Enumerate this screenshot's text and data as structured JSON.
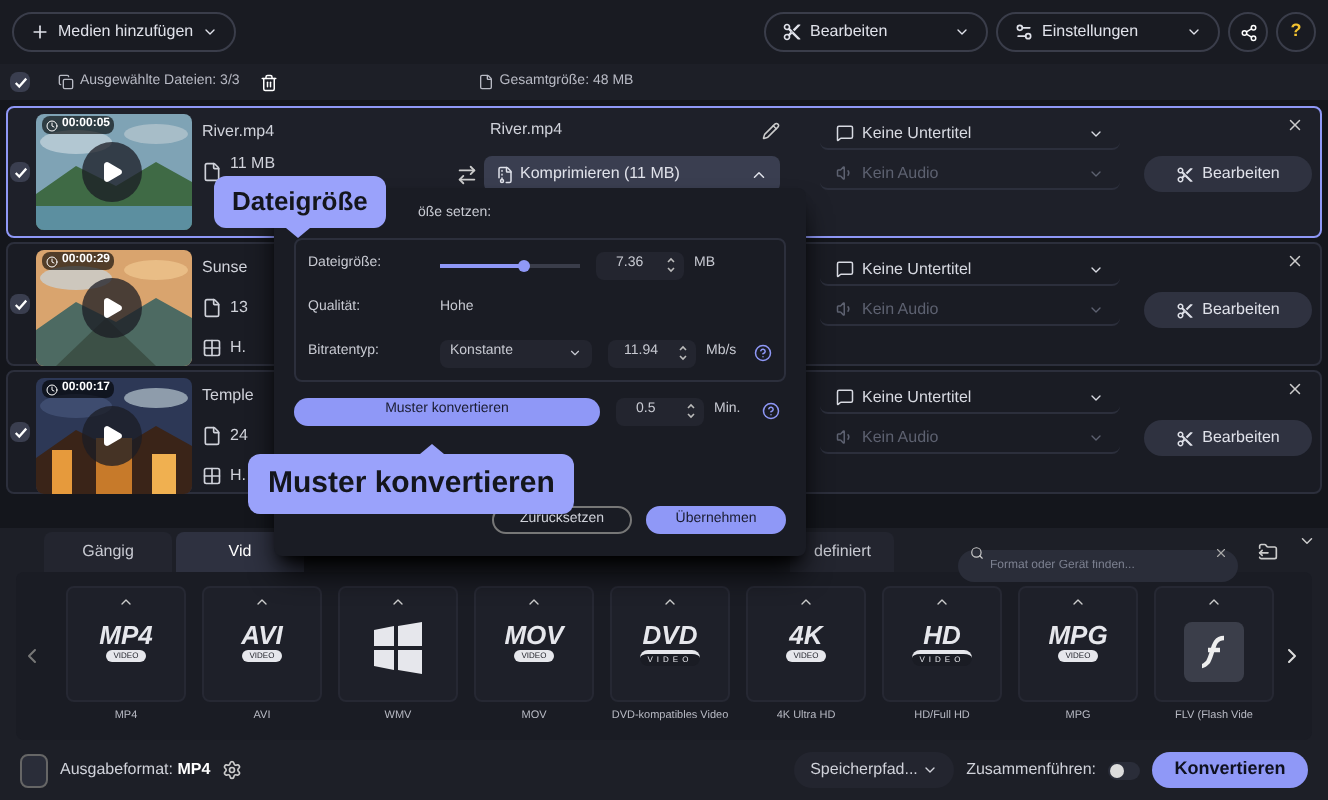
{
  "toolbar": {
    "add_media": "Medien hinzufügen",
    "edit": "Bearbeiten",
    "settings": "Einstellungen",
    "help": "?"
  },
  "selection_bar": {
    "checked": true,
    "selected_files": "Ausgewählte Dateien: 3/3",
    "total_size": "Gesamtgröße: 48 MB"
  },
  "files": [
    {
      "selected": true,
      "checked": true,
      "duration": "00:00:05",
      "name": "River.mp4",
      "size": "11 MB",
      "output_name": "River.mp4",
      "compress": {
        "label": "Komprimieren (11 MB)",
        "expanded": true
      },
      "subtitles": "Keine Untertitel",
      "audio": "Kein Audio",
      "edit": "Bearbeiten"
    },
    {
      "selected": false,
      "checked": true,
      "duration": "00:00:29",
      "name": "Sunse",
      "size": "13",
      "codec": "H.",
      "subtitles": "Keine Untertitel",
      "audio": "Kein Audio",
      "edit": "Bearbeiten"
    },
    {
      "selected": false,
      "checked": true,
      "duration": "00:00:17",
      "name": "Temple",
      "size": "24",
      "codec": "H.",
      "subtitles": "Keine Untertitel",
      "audio": "Kein Audio",
      "edit": "Bearbeiten"
    }
  ],
  "compress_popup": {
    "heading": "öße setzen:",
    "size_label": "Dateigröße:",
    "size": {
      "level": 0.6
    },
    "size_value": "7.36",
    "size_unit": "MB",
    "quality_label": "Qualität:",
    "quality": "Hohe",
    "bitrate_label": "Bitratentyp:",
    "bitrate_type": "Konstante",
    "bitrate_value": "11.94",
    "bitrate_unit": "Mb/s",
    "sample_button": "Muster konvertieren",
    "sample_value": "0.5",
    "sample_unit": "Min.",
    "reset": "Zurücksetzen",
    "apply": "Übernehmen"
  },
  "callouts": [
    {
      "text": "Dateigröße"
    },
    {
      "text": "Muster konvertieren"
    }
  ],
  "format_tabs": [
    {
      "label": "Gängig",
      "selected": false
    },
    {
      "label": "Vid",
      "selected": true
    },
    {
      "label": "definiert",
      "selected": false
    }
  ],
  "format_search": {
    "placeholder": "Format oder Gerät finden..."
  },
  "formats": [
    {
      "kind": "text",
      "logo": "MP4",
      "sub": "VIDEO",
      "label": "MP4"
    },
    {
      "kind": "text",
      "logo": "AVI",
      "sub": "VIDEO",
      "label": "AVI"
    },
    {
      "kind": "windows",
      "label": "WMV"
    },
    {
      "kind": "text",
      "logo": "MOV",
      "sub": "VIDEO",
      "label": "MOV"
    },
    {
      "kind": "disc",
      "logo": "DVD",
      "sub": "VIDEO",
      "label": "DVD-kompatibles Video"
    },
    {
      "kind": "text",
      "logo": "4K",
      "sub": "VIDEO",
      "label": "4K Ultra HD"
    },
    {
      "kind": "disc",
      "logo": "HD",
      "sub": "VIDEO",
      "label": "HD/Full HD"
    },
    {
      "kind": "text",
      "logo": "MPG",
      "sub": "VIDEO",
      "label": "MPG"
    },
    {
      "kind": "flash",
      "label": "FLV (Flash Vide"
    }
  ],
  "bottom_bar": {
    "output_label": "Ausgabeformat:",
    "output_format": "MP4",
    "save_path": "Speicherpfad...",
    "merge_label": "Zusammenführen:",
    "merge": false,
    "convert": "Konvertieren"
  }
}
